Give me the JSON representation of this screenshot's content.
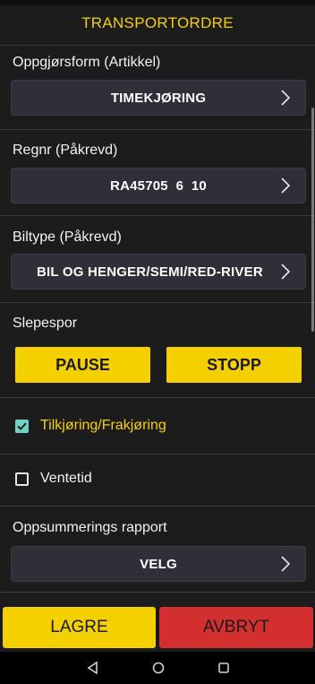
{
  "header": {
    "title": "TRANSPORTORDRE"
  },
  "fields": [
    {
      "label": "Oppgjørsform (Artikkel)",
      "value": "TIMEKJØRING"
    },
    {
      "label": "Regnr (Påkrevd)",
      "value": "RA45705  6  10"
    },
    {
      "label": "Biltype (Påkrevd)",
      "value": "BIL OG HENGER/SEMI/RED-RIVER"
    }
  ],
  "slepespor": {
    "label": "Slepespor",
    "pause_label": "PAUSE",
    "stop_label": "STOPP"
  },
  "options": [
    {
      "label": "Tilkjøring/Frakjøring",
      "checked": true
    },
    {
      "label": "Ventetid",
      "checked": false
    }
  ],
  "summary": {
    "label": "Oppsummerings rapport",
    "value": "VELG"
  },
  "actions": {
    "save_label": "LAGRE",
    "cancel_label": "AVBRYT"
  },
  "colors": {
    "accent": "#f5d000",
    "danger": "#d32f2f",
    "check": "#6fd3c5",
    "selector_bg": "#2e2f38"
  },
  "nav": {
    "icons": [
      "back-icon",
      "home-icon",
      "recents-icon"
    ]
  }
}
